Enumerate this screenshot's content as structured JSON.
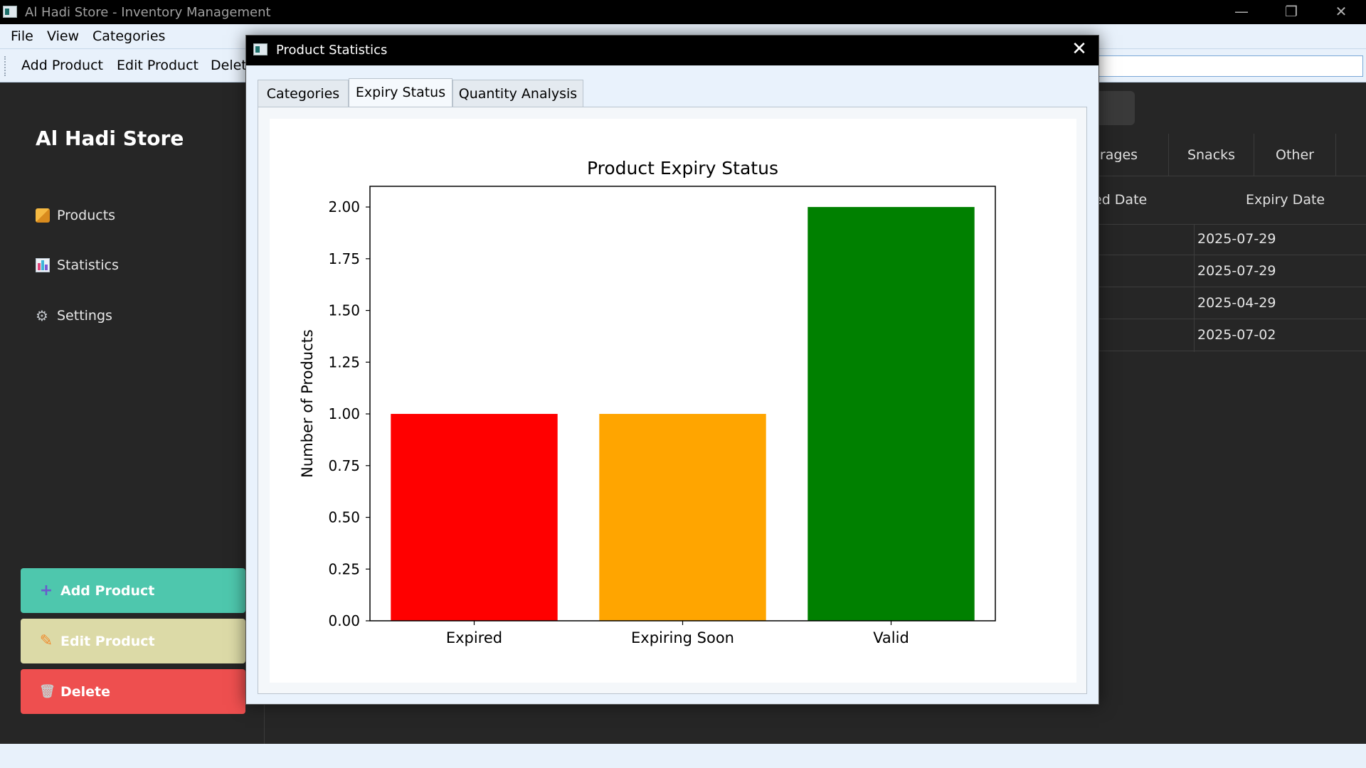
{
  "window": {
    "title": "Al Hadi Store - Inventory Management",
    "buttons": {
      "minimize": "—",
      "restore": "❐",
      "close": "✕"
    }
  },
  "menubar": {
    "file": "File",
    "view": "View",
    "categories": "Categories"
  },
  "toolbar": {
    "add": "Add Product",
    "edit": "Edit Product",
    "delete": "Delete"
  },
  "sidebar": {
    "store_name": "Al Hadi Store",
    "nav": [
      {
        "label": "Products",
        "icon": "box-icon"
      },
      {
        "label": "Statistics",
        "icon": "chart-icon"
      },
      {
        "label": "Settings",
        "icon": "gear-icon"
      }
    ],
    "buttons": {
      "add": "Add Product",
      "edit": "Edit Product",
      "delete": "Delete"
    }
  },
  "content": {
    "category_tabs": [
      "verages",
      "Snacks",
      "Other"
    ],
    "columns": [
      "ed Date",
      "Expiry Date"
    ],
    "expiry_dates": [
      "2025-07-29",
      "2025-07-29",
      "2025-04-29",
      "2025-07-02"
    ]
  },
  "dialog": {
    "title": "Product Statistics",
    "close": "✕",
    "tabs": [
      "Categories",
      "Expiry Status",
      "Quantity Analysis"
    ],
    "active_tab": "Expiry Status"
  },
  "chart_data": {
    "type": "bar",
    "title": "Product Expiry Status",
    "xlabel": "",
    "ylabel": "Number of Products",
    "categories": [
      "Expired",
      "Expiring Soon",
      "Valid"
    ],
    "values": [
      1,
      1,
      2
    ],
    "colors": [
      "#ff0000",
      "#ffa500",
      "#008000"
    ],
    "ylim": [
      0,
      2.1
    ],
    "yticks": [
      "0.00",
      "0.25",
      "0.50",
      "0.75",
      "1.00",
      "1.25",
      "1.50",
      "1.75",
      "2.00"
    ],
    "grid": false
  }
}
